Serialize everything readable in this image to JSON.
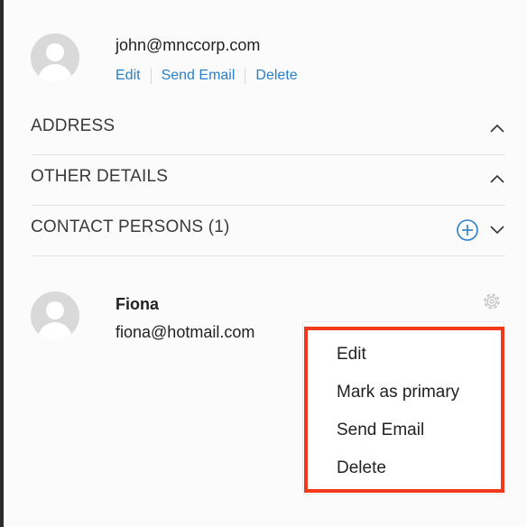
{
  "primary_contact": {
    "email": "john@mnccorp.com",
    "actions": {
      "edit": "Edit",
      "send_email": "Send Email",
      "delete": "Delete"
    }
  },
  "sections": {
    "address": {
      "label": "ADDRESS",
      "state": "collapsed"
    },
    "other_details": {
      "label": "OTHER DETAILS",
      "state": "collapsed"
    },
    "contact_persons": {
      "label": "CONTACT PERSONS (1)",
      "state": "expanded"
    }
  },
  "contact_person": {
    "name": "Fiona",
    "email": "fiona@hotmail.com"
  },
  "context_menu": {
    "items": [
      "Edit",
      "Mark as primary",
      "Send Email",
      "Delete"
    ]
  },
  "colors": {
    "link": "#2a7fc7",
    "highlight_border": "#f23a1a",
    "add_icon": "#2a7fc7"
  },
  "icons": {
    "avatar": "person-avatar-icon",
    "expand": "chevron-icon",
    "add": "plus-circle-icon",
    "settings": "gear-icon"
  }
}
